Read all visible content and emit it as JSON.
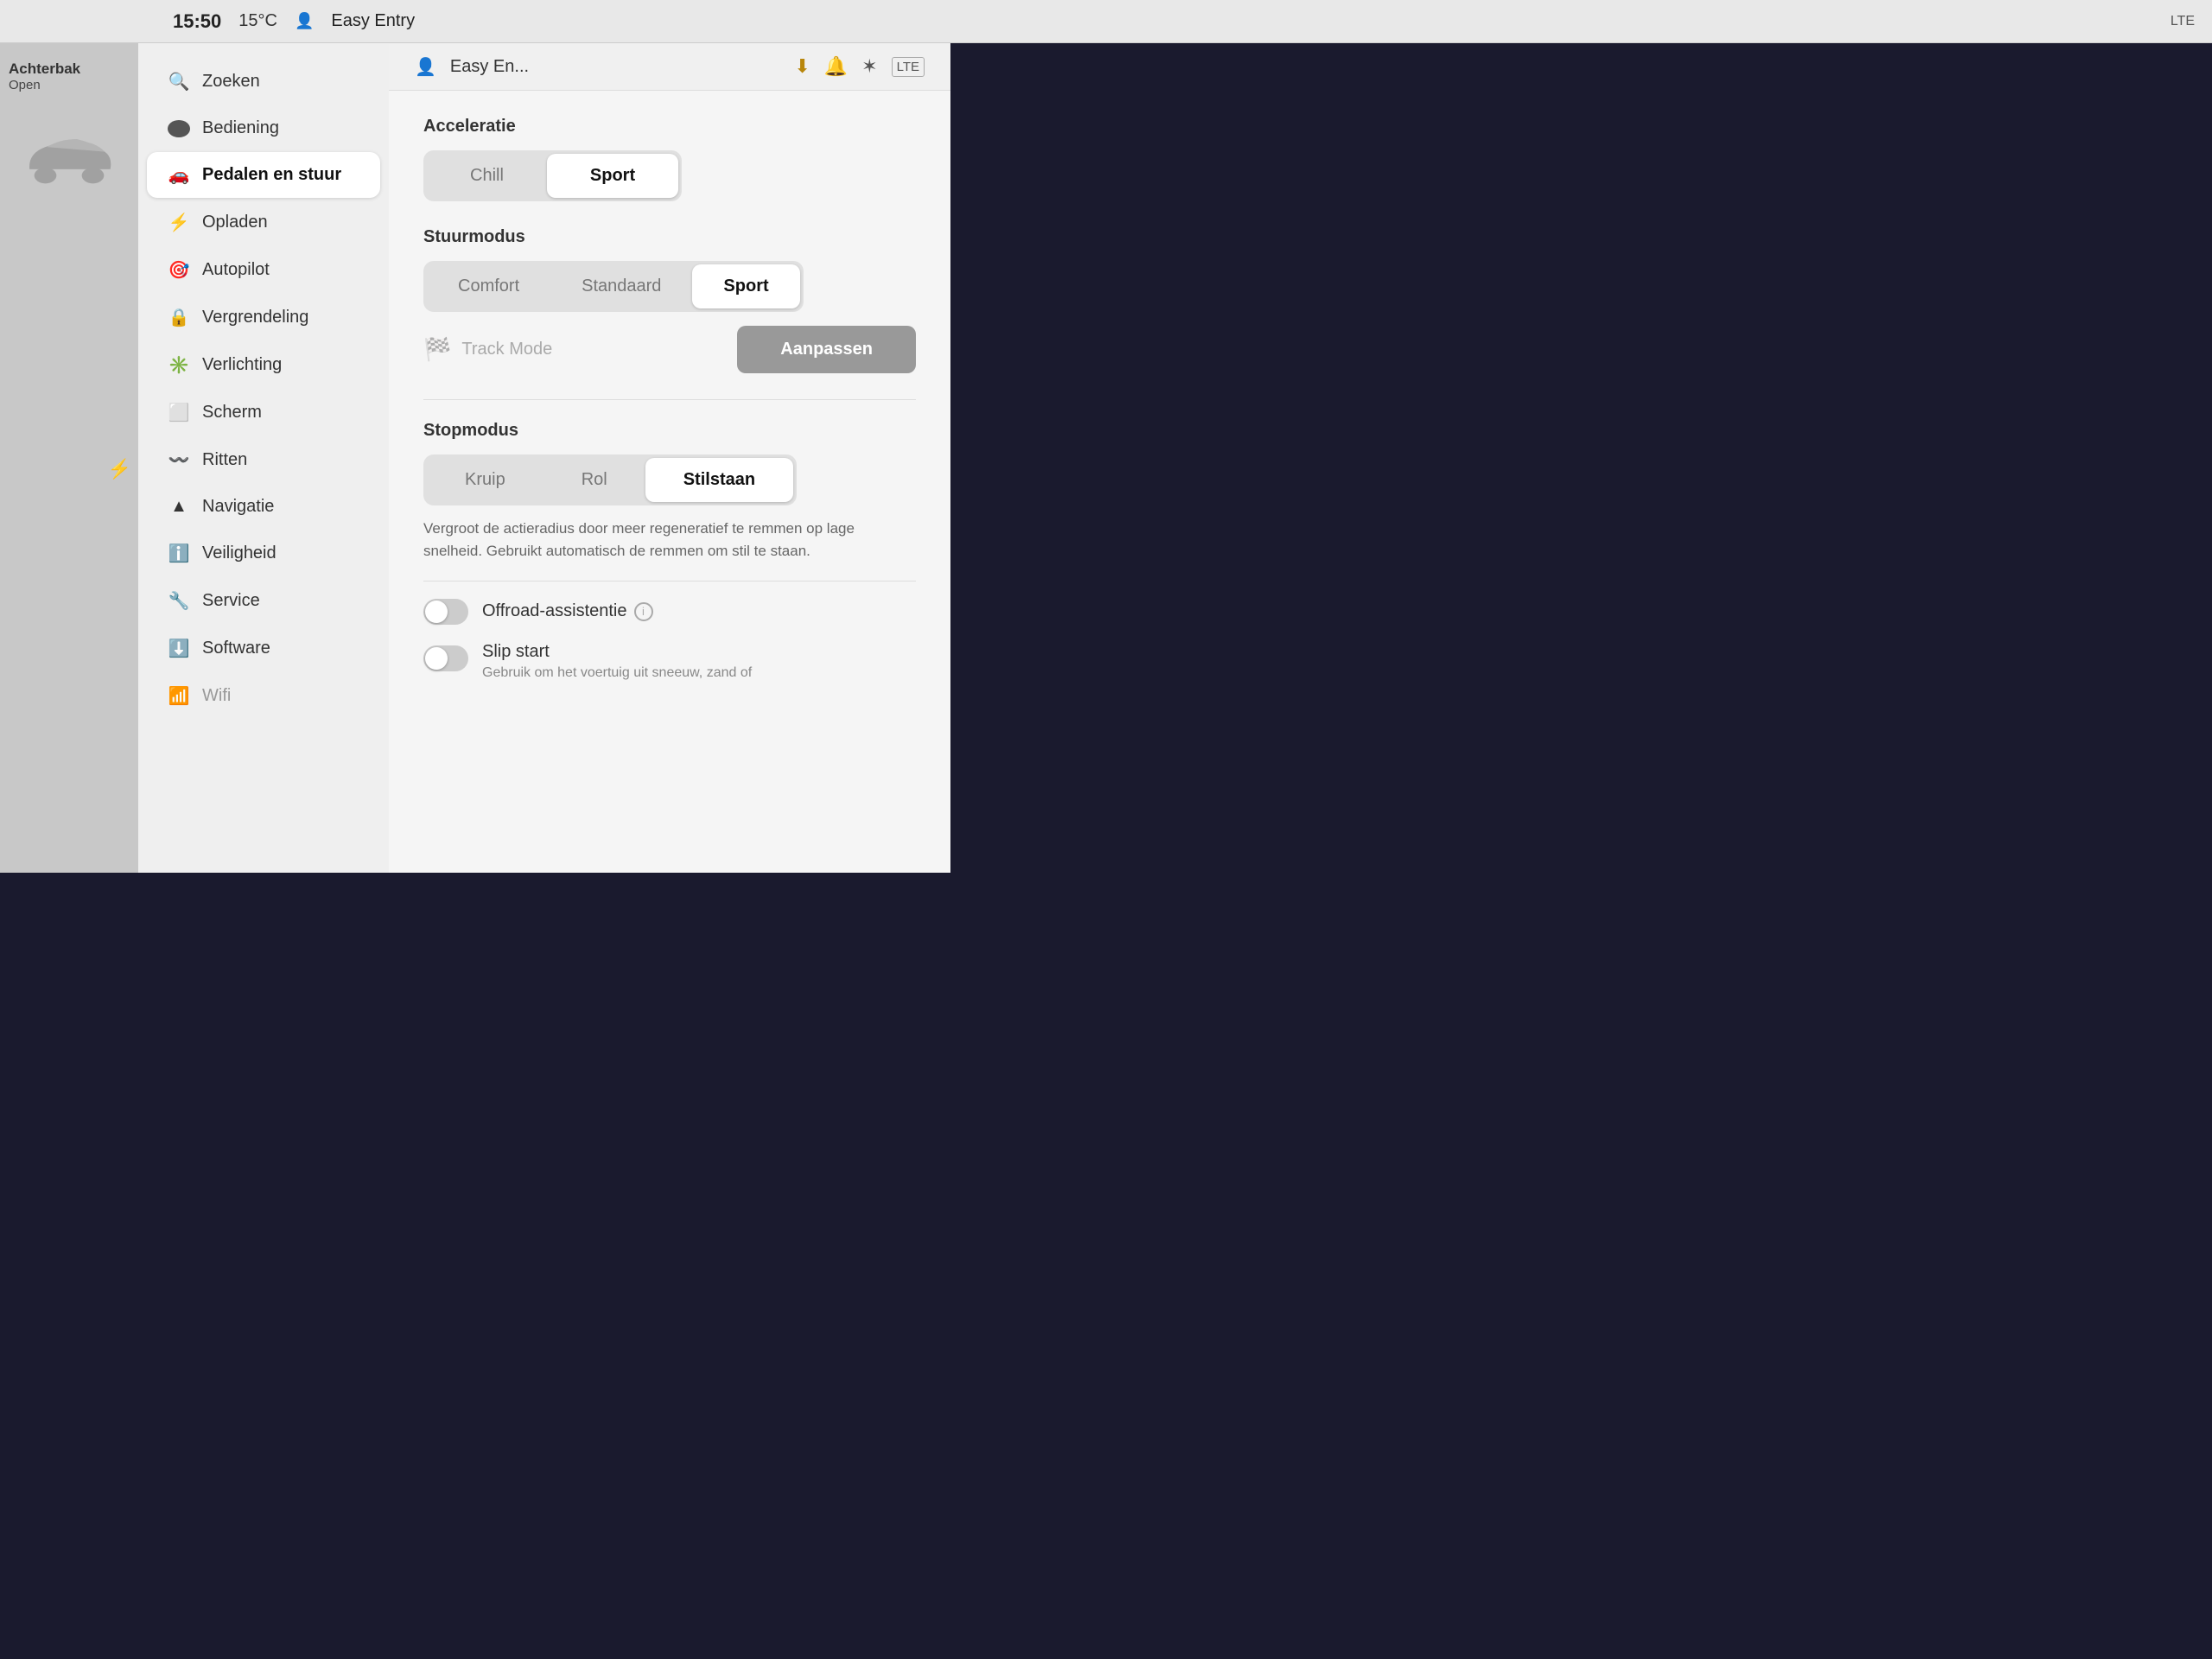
{
  "statusBar": {
    "time": "15:50",
    "temp": "15°C",
    "profile": "Easy Entry",
    "lte": "LTE"
  },
  "leftPanel": {
    "carLabel": "Achterbak",
    "carStatus": "Open"
  },
  "sidebar": {
    "items": [
      {
        "id": "zoeken",
        "label": "Zoeken",
        "icon": "🔍",
        "active": false
      },
      {
        "id": "bediening",
        "label": "Bediening",
        "icon": "⏺",
        "active": false
      },
      {
        "id": "pedalen",
        "label": "Pedalen en stuur",
        "icon": "🚗",
        "active": true
      },
      {
        "id": "opladen",
        "label": "Opladen",
        "icon": "⚡",
        "active": false
      },
      {
        "id": "autopilot",
        "label": "Autopilot",
        "icon": "🎯",
        "active": false
      },
      {
        "id": "vergrendeling",
        "label": "Vergrendeling",
        "icon": "🔒",
        "active": false
      },
      {
        "id": "verlichting",
        "label": "Verlichting",
        "icon": "✳",
        "active": false
      },
      {
        "id": "scherm",
        "label": "Scherm",
        "icon": "⬜",
        "active": false
      },
      {
        "id": "ritten",
        "label": "Ritten",
        "icon": "〰",
        "active": false
      },
      {
        "id": "navigatie",
        "label": "Navigatie",
        "icon": "▲",
        "active": false
      },
      {
        "id": "veiligheid",
        "label": "Veiligheid",
        "icon": "ℹ",
        "active": false
      },
      {
        "id": "service",
        "label": "Service",
        "icon": "🔧",
        "active": false
      },
      {
        "id": "software",
        "label": "Software",
        "icon": "⬇",
        "active": false
      },
      {
        "id": "wifi",
        "label": "Wifi",
        "icon": "📶",
        "active": false
      }
    ]
  },
  "contentHeader": {
    "profileName": "Easy En...",
    "downloadIcon": "⬇",
    "bellIcon": "🔔",
    "bluetoothIcon": "✶",
    "lteIcon": "LTE"
  },
  "acceleratie": {
    "title": "Acceleratie",
    "options": [
      {
        "id": "chill",
        "label": "Chill",
        "active": false
      },
      {
        "id": "sport",
        "label": "Sport",
        "active": true
      }
    ]
  },
  "stuurmodus": {
    "title": "Stuurmodus",
    "options": [
      {
        "id": "comfort",
        "label": "Comfort",
        "active": false
      },
      {
        "id": "standaard",
        "label": "Standaard",
        "active": false
      },
      {
        "id": "sport",
        "label": "Sport",
        "active": true
      }
    ]
  },
  "trackMode": {
    "icon": "🏁",
    "label": "Track Mode",
    "buttonLabel": "Aanpassen"
  },
  "stopmodus": {
    "title": "Stopmodus",
    "options": [
      {
        "id": "kruip",
        "label": "Kruip",
        "active": false
      },
      {
        "id": "rol",
        "label": "Rol",
        "active": false
      },
      {
        "id": "stilstaan",
        "label": "Stilstaan",
        "active": true
      }
    ],
    "description": "Vergroot de actieradius door meer regeneratief te remmen op lage snelheid. Gebruikt automatisch de remmen om stil te staan."
  },
  "offroadAssistentie": {
    "label": "Offroad-assistentie",
    "hasInfo": true
  },
  "slipStart": {
    "label": "Slip start",
    "description": "Gebruik om het voertuig uit sneeuw, zand of"
  }
}
